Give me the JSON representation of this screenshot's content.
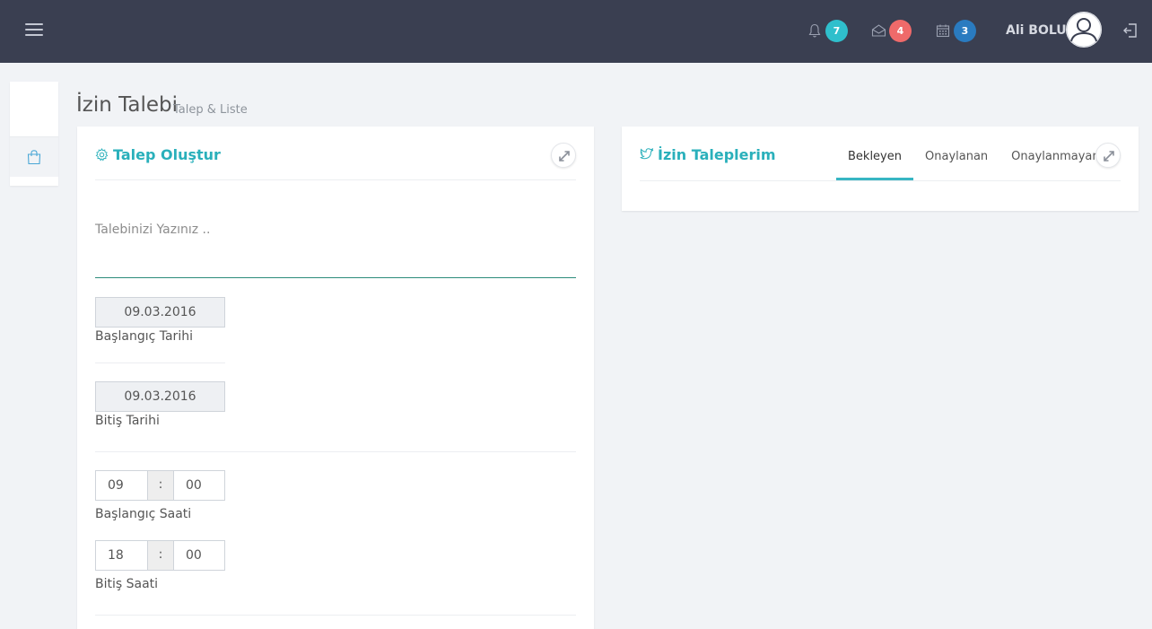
{
  "header": {
    "user_name": "Ali BOLU",
    "notifications": {
      "icon": "bell-icon",
      "count": "7",
      "color": "#2fbfcc"
    },
    "messages": {
      "icon": "envelope-open-icon",
      "count": "4",
      "color": "#ef6a6a"
    },
    "calendar": {
      "icon": "calendar-icon",
      "count": "3",
      "color": "#2a7bc0"
    }
  },
  "page": {
    "title": "İzin Talebi",
    "subtitle": "Talep & Liste"
  },
  "request_panel": {
    "title": "Talep Oluştur",
    "request_placeholder": "Talebinizi Yazınız ..",
    "start_date": {
      "value": "09.03.2016",
      "label": "Başlangıç Tarihi"
    },
    "end_date": {
      "value": "09.03.2016",
      "label": "Bitiş Tarihi"
    },
    "start_time": {
      "hour": "09",
      "separator": ":",
      "minute": "00",
      "label": "Başlangıç Saati"
    },
    "end_time": {
      "hour": "18",
      "separator": ":",
      "minute": "00",
      "label": "Bitiş Saati"
    }
  },
  "list_panel": {
    "title": "İzin Taleplerim",
    "tabs": [
      {
        "label": "Bekleyen",
        "active": true
      },
      {
        "label": "Onaylanan",
        "active": false
      },
      {
        "label": "Onaylanmayan",
        "active": false
      }
    ]
  },
  "colors": {
    "accent": "#2ab0bb",
    "topbar": "#3a3f51",
    "underline": "#2b8c7b"
  }
}
